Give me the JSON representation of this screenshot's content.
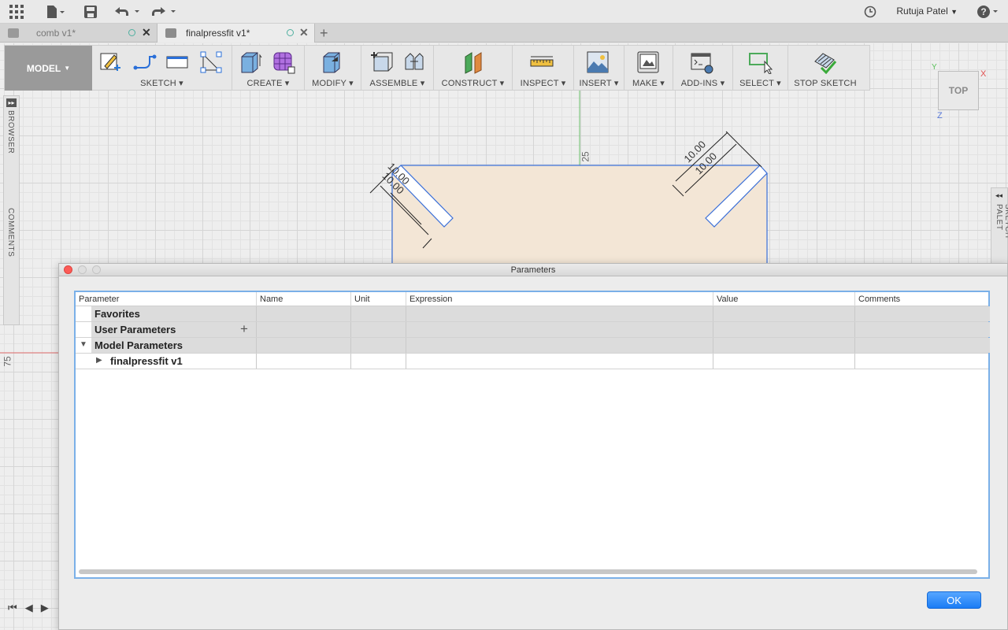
{
  "topbar": {
    "user_name": "Rutuja Patel",
    "icons": [
      "grid-icon",
      "file-icon",
      "save-icon",
      "undo-icon",
      "redo-icon",
      "clock-icon",
      "help-icon"
    ]
  },
  "tabs": [
    {
      "label": "comb v1*"
    },
    {
      "label": "finalpressfit v1*"
    }
  ],
  "toolbar": {
    "model_label": "MODEL",
    "groups": [
      "SKETCH",
      "CREATE",
      "MODIFY",
      "ASSEMBLE",
      "CONSTRUCT",
      "INSPECT",
      "INSERT",
      "MAKE",
      "ADD-INS",
      "SELECT",
      "STOP SKETCH"
    ]
  },
  "side": {
    "browser_label": "BROWSER",
    "comments_label": "COMMENTS",
    "sketch_palette_label": "SKETCH PALET"
  },
  "viewcube": {
    "label": "TOP",
    "axis_y": "Y",
    "axis_x": "X",
    "axis_z": "Z"
  },
  "sketch": {
    "dim_a1": "10.00",
    "dim_a2": "10.00",
    "dim_b1": "10.00",
    "dim_b2": "10.00",
    "axis_25": "25",
    "axis_75": "75"
  },
  "dialog": {
    "title": "Parameters",
    "columns": [
      "Parameter",
      "Name",
      "Unit",
      "Expression",
      "Value",
      "Comments"
    ],
    "rows": {
      "favorites": "Favorites",
      "user_params": "User Parameters",
      "model_params": "Model Parameters",
      "component": "finalpressfit v1"
    },
    "ok_label": "OK"
  },
  "colors": {
    "accent": "#1a7cf5",
    "sketch_fill": "#f3e6d6",
    "sketch_line": "#3a6fd8"
  }
}
